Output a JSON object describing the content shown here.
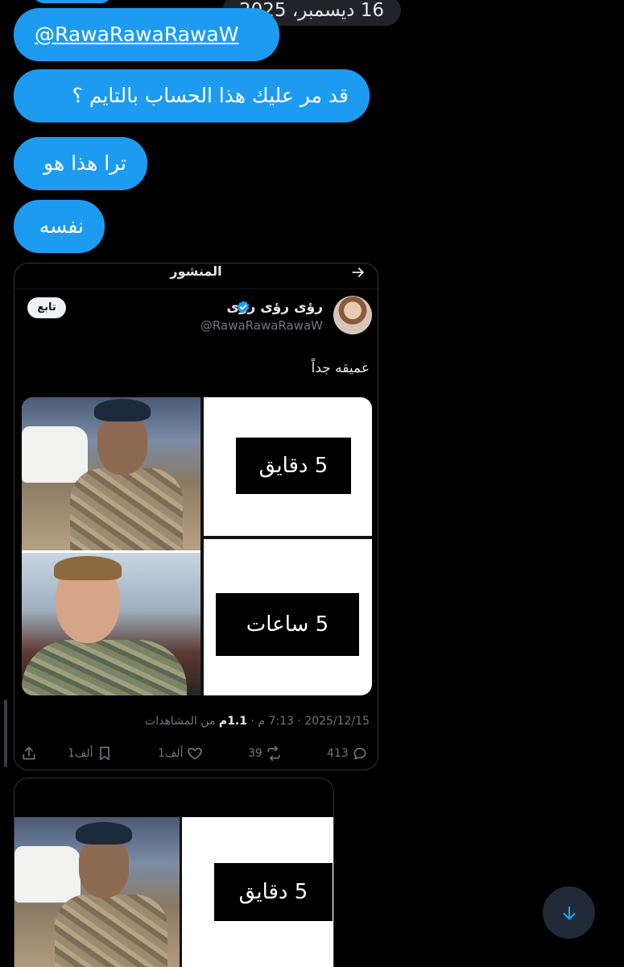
{
  "date_separator": "16 ديسمبر، 2025",
  "messages": [
    {
      "text": "@RawaRawaRawaW"
    },
    {
      "text": "قد مر عليك هذا الحساب بالتايم ؟"
    },
    {
      "text": "ترا هذا هو"
    },
    {
      "text": "نفسه"
    }
  ],
  "post_card": {
    "header_title": "المنشور",
    "author": {
      "name": "رؤى رؤى رؤى",
      "handle": "@RawaRawaRawaW",
      "verified": true
    },
    "follow_label": "تابع",
    "tweet_text": "عميقه جداً",
    "meme": {
      "box1": "5  دقايق",
      "box2": "5  ساعات"
    },
    "meta": {
      "date": "2025/12/15",
      "time": "7:13 م",
      "views_count": "1.1م",
      "views_label": "من المشاهدات"
    },
    "actions": {
      "replies": "413",
      "retweets": "39",
      "likes": "1ألف",
      "bookmarks": "1ألف"
    }
  },
  "second_card": {
    "meme_box": "5  دقايق"
  },
  "colors": {
    "background": "#000000",
    "bubble_blue": "#1d9bf0",
    "secondary_text": "#71767b",
    "card_border": "#2f3336"
  },
  "icons": [
    "arrow-right-icon",
    "verified-badge-icon",
    "share-icon",
    "bookmark-icon",
    "heart-icon",
    "retweet-icon",
    "reply-icon",
    "arrow-down-icon"
  ]
}
